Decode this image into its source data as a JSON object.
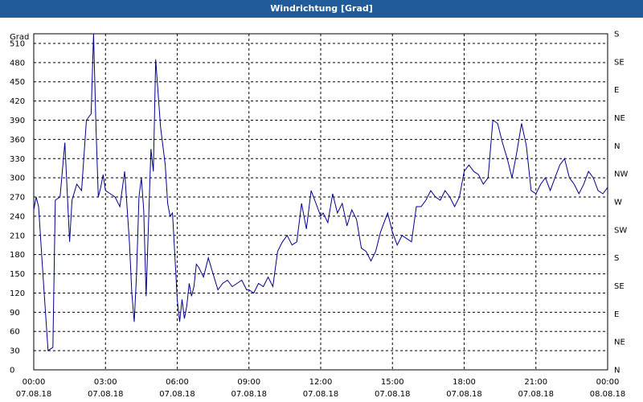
{
  "title": "Windrichtung [Grad]",
  "chart_data": {
    "type": "line",
    "ylabel": "Grad",
    "ylim": [
      0,
      525
    ],
    "yticks": [
      0,
      30,
      60,
      90,
      120,
      150,
      180,
      210,
      240,
      270,
      300,
      330,
      360,
      390,
      420,
      450,
      480,
      510
    ],
    "right_axis": {
      "labels": [
        "N",
        "NE",
        "E",
        "SE",
        "S",
        "SW",
        "W",
        "NW",
        "N",
        "NE",
        "E",
        "SE",
        "S"
      ],
      "values": [
        0,
        30,
        67.5,
        90,
        112.5,
        135,
        157.5,
        180,
        202.5,
        225,
        247.5,
        270,
        292.5,
        315,
        337.5,
        360,
        382.5,
        405,
        427.5,
        450,
        472.5,
        495,
        517.5
      ]
    },
    "xlim": [
      0,
      24
    ],
    "xticks": [
      {
        "time": "00:00",
        "date": "07.08.18"
      },
      {
        "time": "03:00",
        "date": "07.08.18"
      },
      {
        "time": "06:00",
        "date": "07.08.18"
      },
      {
        "time": "09:00",
        "date": "07.08.18"
      },
      {
        "time": "12:00",
        "date": "07.08.18"
      },
      {
        "time": "15:00",
        "date": "07.08.18"
      },
      {
        "time": "18:00",
        "date": "07.08.18"
      },
      {
        "time": "21:00",
        "date": "07.08.18"
      },
      {
        "time": "00:00",
        "date": "08.08.18"
      }
    ],
    "grid": true,
    "line_color": "#00008b",
    "series": [
      {
        "x": [
          0.0,
          0.1,
          0.2,
          0.4,
          0.6,
          0.8,
          0.9,
          1.1,
          1.3,
          1.5,
          1.6,
          1.8,
          2.0,
          2.2,
          2.4,
          2.5,
          2.6,
          2.7,
          2.8,
          2.9,
          3.0,
          3.2,
          3.4,
          3.6,
          3.8,
          4.0,
          4.1,
          4.2,
          4.3,
          4.4,
          4.5,
          4.6,
          4.7,
          4.8,
          4.9,
          5.0,
          5.1,
          5.3,
          5.5,
          5.6,
          5.7,
          5.8,
          5.9,
          6.0,
          6.1,
          6.2,
          6.3,
          6.4,
          6.5,
          6.6,
          6.7,
          6.8,
          6.9,
          7.1,
          7.3,
          7.5,
          7.7,
          7.9,
          8.1,
          8.3,
          8.5,
          8.7,
          8.9,
          9.0,
          9.2,
          9.4,
          9.6,
          9.8,
          10.0,
          10.2,
          10.4,
          10.6,
          10.8,
          11.0,
          11.2,
          11.4,
          11.6,
          11.8,
          12.0,
          12.1,
          12.3,
          12.5,
          12.7,
          12.9,
          13.1,
          13.3,
          13.5,
          13.7,
          13.9,
          14.1,
          14.3,
          14.5,
          14.6,
          14.8,
          15.0,
          15.2,
          15.4,
          15.6,
          15.8,
          16.0,
          16.2,
          16.4,
          16.6,
          16.8,
          17.0,
          17.2,
          17.4,
          17.6,
          17.8,
          18.0,
          18.2,
          18.4,
          18.6,
          18.8,
          19.0,
          19.2,
          19.4,
          19.6,
          19.8,
          20.0,
          20.2,
          20.4,
          20.6,
          20.8,
          21.0,
          21.2,
          21.4,
          21.6,
          21.8,
          22.0,
          22.2,
          22.4,
          22.6,
          22.8,
          23.0,
          23.2,
          23.4,
          23.6,
          23.8,
          24.0
        ],
        "values": [
          250,
          270,
          255,
          140,
          30,
          35,
          265,
          270,
          355,
          200,
          265,
          290,
          280,
          390,
          400,
          525,
          380,
          270,
          285,
          305,
          280,
          275,
          270,
          255,
          310,
          200,
          120,
          75,
          150,
          270,
          300,
          250,
          115,
          230,
          345,
          310,
          485,
          380,
          320,
          260,
          240,
          245,
          180,
          110,
          75,
          110,
          80,
          100,
          135,
          115,
          130,
          165,
          160,
          145,
          175,
          150,
          125,
          135,
          140,
          130,
          135,
          140,
          125,
          125,
          120,
          135,
          130,
          145,
          130,
          185,
          200,
          210,
          195,
          200,
          260,
          220,
          280,
          260,
          240,
          245,
          230,
          275,
          245,
          260,
          225,
          250,
          235,
          190,
          185,
          170,
          185,
          215,
          225,
          245,
          215,
          195,
          210,
          205,
          200,
          255,
          255,
          265,
          280,
          270,
          265,
          280,
          270,
          255,
          270,
          310,
          320,
          310,
          305,
          290,
          300,
          390,
          385,
          355,
          330,
          300,
          340,
          385,
          350,
          280,
          275,
          290,
          300,
          280,
          300,
          320,
          330,
          300,
          290,
          275,
          290,
          310,
          300,
          280,
          275,
          285
        ]
      }
    ]
  }
}
